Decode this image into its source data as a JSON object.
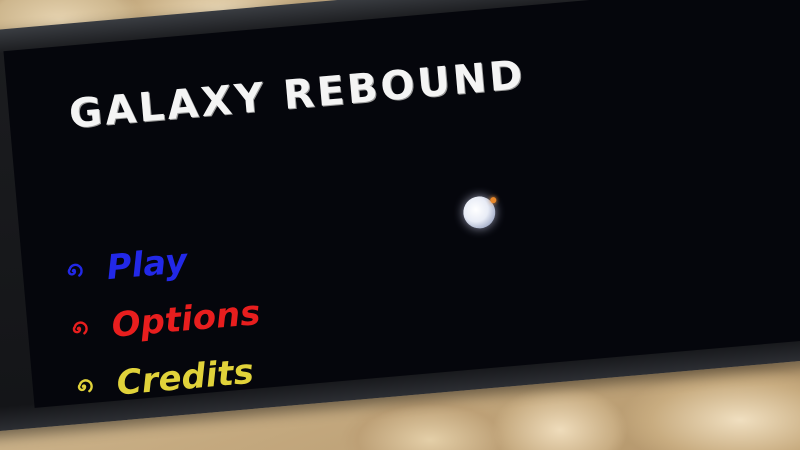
{
  "game": {
    "title": "GALAXY REBOUND"
  },
  "menu": {
    "items": [
      {
        "label": "Play",
        "color": "#2228e8",
        "icon": "blue-swirl-icon"
      },
      {
        "label": "Options",
        "color": "#e81e1e",
        "icon": "red-swirl-icon"
      },
      {
        "label": "Credits",
        "color": "#e0d23a",
        "icon": "yellow-swirl-icon"
      }
    ]
  },
  "colors": {
    "screen_background": "#05060c",
    "title_text": "#f4f4f4",
    "ball": "#f2f4fa",
    "ball_spark": "#e8882a"
  }
}
